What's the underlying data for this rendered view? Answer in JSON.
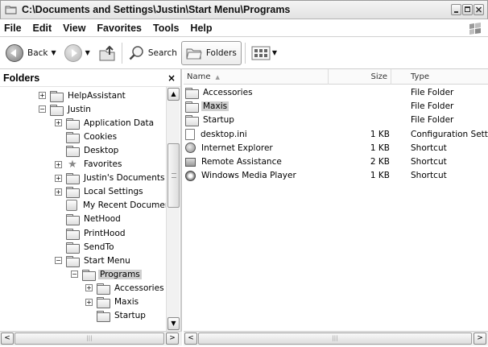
{
  "window": {
    "title": "C:\\Documents and Settings\\Justin\\Start Menu\\Programs"
  },
  "menu": [
    "File",
    "Edit",
    "View",
    "Favorites",
    "Tools",
    "Help"
  ],
  "toolbar": {
    "back_label": "Back",
    "search_label": "Search",
    "folders_label": "Folders"
  },
  "folders_pane": {
    "title": "Folders",
    "close_glyph": "×",
    "items": [
      {
        "label": "HelpAssistant",
        "level": 0,
        "expander": "+",
        "icon": "folder-icon"
      },
      {
        "label": "Justin",
        "level": 0,
        "expander": "−",
        "icon": "folder-icon"
      },
      {
        "label": "Application Data",
        "level": 1,
        "expander": "+",
        "icon": "folder-icon"
      },
      {
        "label": "Cookies",
        "level": 1,
        "expander": "",
        "icon": "folder-icon"
      },
      {
        "label": "Desktop",
        "level": 1,
        "expander": "",
        "icon": "folder-icon"
      },
      {
        "label": "Favorites",
        "level": 1,
        "expander": "+",
        "icon": "star-icon"
      },
      {
        "label": "Justin's Documents",
        "level": 1,
        "expander": "+",
        "icon": "folder-icon"
      },
      {
        "label": "Local Settings",
        "level": 1,
        "expander": "+",
        "icon": "folder-icon"
      },
      {
        "label": "My Recent Documen",
        "level": 1,
        "expander": "",
        "icon": "recent-documents-icon"
      },
      {
        "label": "NetHood",
        "level": 1,
        "expander": "",
        "icon": "folder-icon"
      },
      {
        "label": "PrintHood",
        "level": 1,
        "expander": "",
        "icon": "folder-icon"
      },
      {
        "label": "SendTo",
        "level": 1,
        "expander": "",
        "icon": "folder-icon"
      },
      {
        "label": "Start Menu",
        "level": 1,
        "expander": "−",
        "icon": "folder-icon"
      },
      {
        "label": "Programs",
        "level": 2,
        "expander": "−",
        "icon": "open-folder-icon",
        "selected": true
      },
      {
        "label": "Accessories",
        "level": 3,
        "expander": "+",
        "icon": "folder-icon"
      },
      {
        "label": "Maxis",
        "level": 3,
        "expander": "+",
        "icon": "folder-icon"
      },
      {
        "label": "Startup",
        "level": 3,
        "expander": "",
        "icon": "folder-icon"
      }
    ]
  },
  "file_list": {
    "columns": {
      "name": "Name",
      "size": "Size",
      "type": "Type"
    },
    "rows": [
      {
        "name": "Accessories",
        "size": "",
        "type": "File Folder",
        "icon": "folder-icon"
      },
      {
        "name": "Maxis",
        "size": "",
        "type": "File Folder",
        "icon": "folder-icon",
        "selected": true
      },
      {
        "name": "Startup",
        "size": "",
        "type": "File Folder",
        "icon": "folder-icon"
      },
      {
        "name": "desktop.ini",
        "size": "1 KB",
        "type": "Configuration Settings",
        "icon": "settings-file-icon"
      },
      {
        "name": "Internet Explorer",
        "size": "1 KB",
        "type": "Shortcut",
        "icon": "internet-explorer-icon"
      },
      {
        "name": "Remote Assistance",
        "size": "2 KB",
        "type": "Shortcut",
        "icon": "remote-assistance-icon"
      },
      {
        "name": "Windows Media Player",
        "size": "1 KB",
        "type": "Shortcut",
        "icon": "media-player-icon"
      }
    ]
  },
  "scrollbars": {
    "left_arrow": "<",
    "right_arrow": ">",
    "up_arrow": "▲",
    "down_arrow": "▼",
    "grip": "|||"
  }
}
